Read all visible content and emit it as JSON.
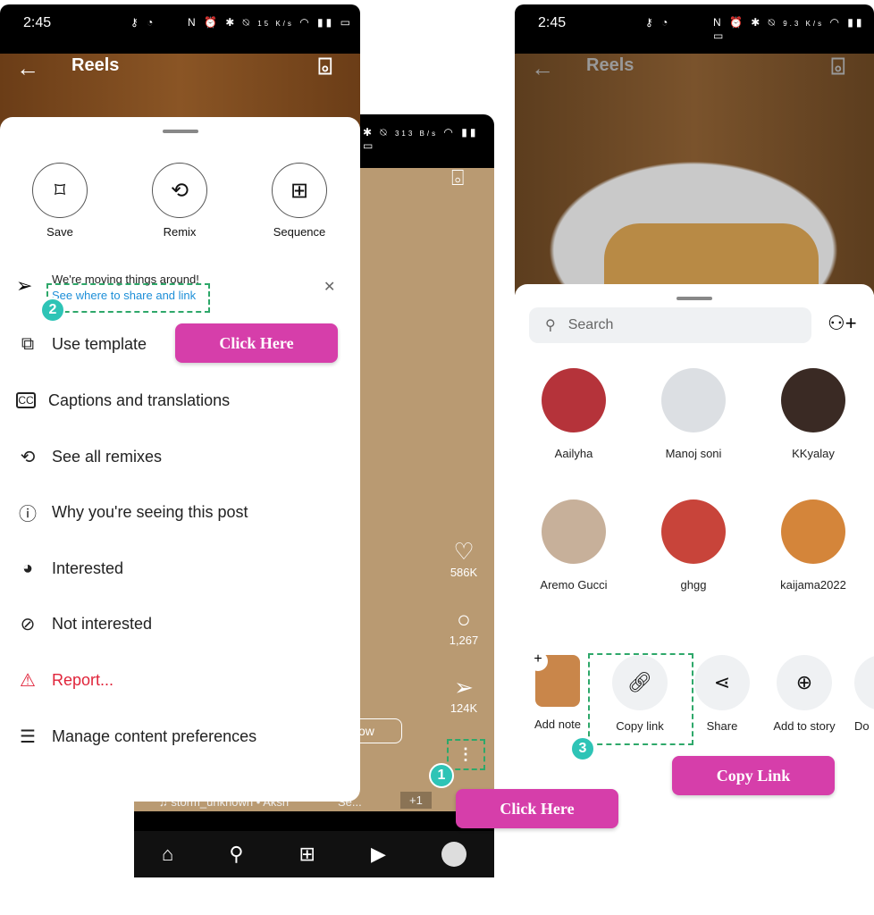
{
  "phone1": {
    "status": {
      "time": "2:45",
      "speed": "15 K/s"
    },
    "header": {
      "title": "Reels"
    },
    "top_actions": [
      {
        "label": "Save",
        "icon": "bookmark-icon"
      },
      {
        "label": "Remix",
        "icon": "remix-icon"
      },
      {
        "label": "Sequence",
        "icon": "sequence-icon"
      }
    ],
    "notice": {
      "text": "We're moving things around!",
      "link": "See where to share and link"
    },
    "menu": [
      {
        "label": "Use template",
        "icon": "template-icon"
      },
      {
        "label": "Captions and translations",
        "icon": "captions-icon"
      },
      {
        "label": "See all remixes",
        "icon": "remix-icon"
      },
      {
        "label": "Why you're seeing this post",
        "icon": "info-icon"
      },
      {
        "label": "Interested",
        "icon": "eye-icon"
      },
      {
        "label": "Not interested",
        "icon": "eye-off-icon"
      },
      {
        "label": "Report...",
        "icon": "report-icon",
        "color": "#e0243a"
      },
      {
        "label": "Manage content preferences",
        "icon": "sliders-icon"
      }
    ]
  },
  "phone2": {
    "status": {
      "speed": "313 B/s"
    },
    "likes": "586K",
    "comments": "1,267",
    "shares": "124K",
    "follow_partial": "ow",
    "audio": "storm_unknown • Aksh",
    "tag": "Se...",
    "plus": "+1",
    "nav": [
      "home-icon",
      "search-icon",
      "create-icon",
      "reels-icon",
      "profile-icon"
    ]
  },
  "phone3": {
    "status": {
      "time": "2:45",
      "speed": "9.3 K/s"
    },
    "header": {
      "title": "Reels"
    },
    "search": {
      "placeholder": "Search"
    },
    "contacts": [
      {
        "name": "Aailyha"
      },
      {
        "name": "Manoj soni"
      },
      {
        "name": "KKyalay"
      },
      {
        "name": "Aremo Gucci"
      },
      {
        "name": "ghgg"
      },
      {
        "name": "kaijama2022"
      }
    ],
    "actions": [
      {
        "label": "Add note"
      },
      {
        "label": "Copy link",
        "icon": "link-icon"
      },
      {
        "label": "Share",
        "icon": "share-icon"
      },
      {
        "label": "Add to story",
        "icon": "add-story-icon"
      },
      {
        "label": "Do"
      }
    ]
  },
  "annotations": {
    "steps": [
      "1",
      "2",
      "3"
    ],
    "click_here_1": "Click Here",
    "click_here_2": "Click Here",
    "copy_link": "Copy Link",
    "accent": "#d63eaa",
    "badge_color": "#2ec4b6",
    "dash_color": "#2ea86a"
  }
}
